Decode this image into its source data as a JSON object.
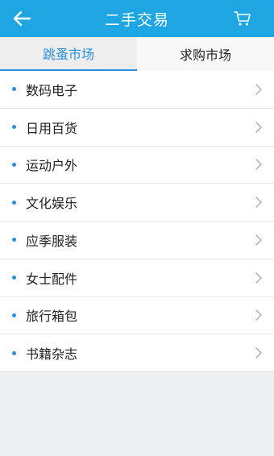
{
  "header": {
    "title": "二手交易",
    "back_icon": "arrow-left-icon",
    "cart_icon": "cart-icon"
  },
  "tabs": [
    {
      "label": "跳蚤市场",
      "active": true
    },
    {
      "label": "求购市场",
      "active": false
    }
  ],
  "categories": [
    {
      "label": "数码电子"
    },
    {
      "label": "日用百货"
    },
    {
      "label": "运动户外"
    },
    {
      "label": "文化娱乐"
    },
    {
      "label": "应季服装"
    },
    {
      "label": "女士配件"
    },
    {
      "label": "旅行箱包"
    },
    {
      "label": "书籍杂志"
    }
  ],
  "colors": {
    "header_bg": "#1ea6e3",
    "accent": "#2a90dc"
  }
}
